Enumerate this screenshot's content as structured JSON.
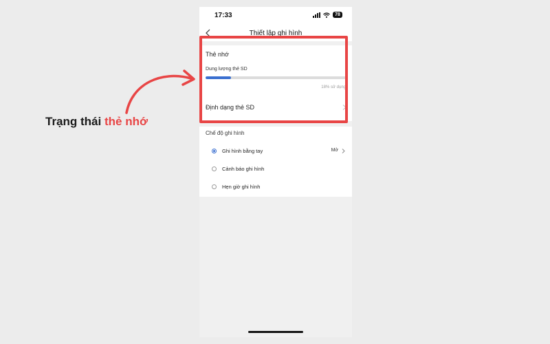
{
  "status_bar": {
    "time": "17:33",
    "battery": "78"
  },
  "nav": {
    "title": "Thiết lập ghi hình"
  },
  "memory_card": {
    "title": "Thẻ nhớ",
    "capacity_label": "Dung lượng thẻ SD",
    "usage_text": "18% sử dụng",
    "usage_fraction": 0.18,
    "format_label": "Định dạng thẻ SD"
  },
  "record_mode": {
    "title": "Chế độ ghi hình",
    "options": [
      {
        "label": "Ghi hình bằng tay",
        "value": "Mở",
        "selected": true
      },
      {
        "label": "Cảnh báo ghi hình",
        "selected": false
      },
      {
        "label": "Hẹn giờ ghi hình",
        "selected": false
      }
    ]
  },
  "annotation": {
    "prefix": "Trạng thái ",
    "highlight": "thẻ nhớ"
  },
  "colors": {
    "accent": "#3a6fd0",
    "annotation_red": "#e84545"
  }
}
